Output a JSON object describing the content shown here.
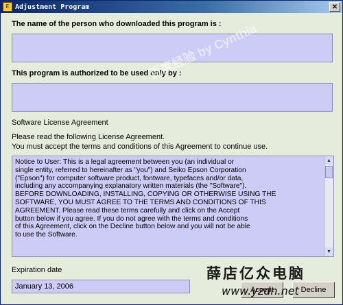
{
  "window": {
    "title": "Adjustment Program",
    "close_label": "✕"
  },
  "form": {
    "downloader_label": "The name of the person who downloaded this program is :",
    "downloader_value": "",
    "authorized_label": "This program is authorized to be used only by :",
    "authorized_value": "",
    "license_heading": "Software License Agreement",
    "instruction_line1": "Please read the following License Agreement.",
    "instruction_line2": "You must accept the terms and conditions of this Agreement to continue use.",
    "license_text": "Notice to User: This is a legal agreement between you (an individual or\nsingle entity, referred to hereinafter as \"you\") and Seiko Epson Corporation\n(\"Epson\") for computer software product, fontware, typefaces and/or data,\nincluding any accompanying explanatory written materials (the \"Software\").\nBEFORE DOWNLOADING, INSTALLING, COPYING OR OTHERWISE USING THE\nSOFTWARE, YOU MUST AGREE TO THE TERMS AND CONDITIONS OF THIS\nAGREEMENT.  Please read these terms carefully and click on the Accept\nbutton below if you agree.  If you do not agree with the terms and conditions\nof this Agreement, click on the Decline button below and you will not be able\nto use the Software.",
    "expiration_label": "Expiration date",
    "expiration_value": "January 13, 2006",
    "accept_label": "Accept",
    "decline_label": "Decline"
  },
  "watermarks": {
    "diagonal": "百度经验 by Cynthia",
    "chinese": "薛店亿众电脑",
    "url": "www.yzdn.net"
  },
  "colors": {
    "field_bg": "#ccccf7",
    "window_bg": "#e6ecdb",
    "titlebar": "#0a246a"
  }
}
